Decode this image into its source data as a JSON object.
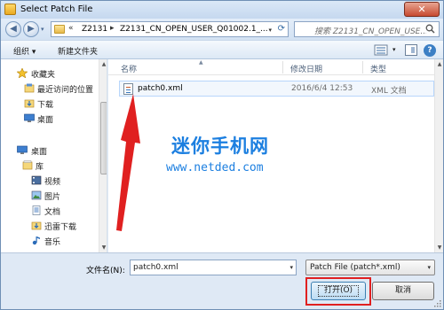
{
  "window": {
    "title": "Select Patch File",
    "close_label": "✕"
  },
  "address": {
    "chevron": "«",
    "segment1": "Z2131",
    "separator": "▸",
    "segment2": "Z2131_CN_OPEN_USER_Q01002.1_...",
    "search_placeholder": "搜索 Z2131_CN_OPEN_USE..."
  },
  "toolbar": {
    "organize": "组织 ▾",
    "new_folder": "新建文件夹",
    "help": "?"
  },
  "nav": {
    "items": [
      {
        "label": "收藏夹",
        "icon": "star-icon"
      },
      {
        "label": "最近访问的位置",
        "icon": "recent-places-icon"
      },
      {
        "label": "下载",
        "icon": "download-folder-icon"
      },
      {
        "label": "桌面",
        "icon": "desktop-icon"
      },
      {
        "label": "桌面",
        "icon": "desktop-icon"
      },
      {
        "label": "库",
        "icon": "library-icon"
      },
      {
        "label": "视频",
        "icon": "video-icon"
      },
      {
        "label": "图片",
        "icon": "pictures-icon"
      },
      {
        "label": "文档",
        "icon": "documents-icon"
      },
      {
        "label": "迅雷下载",
        "icon": "thunder-download-icon"
      },
      {
        "label": "音乐",
        "icon": "music-icon"
      }
    ]
  },
  "columns": {
    "name": "名称",
    "modified": "修改日期",
    "type": "类型"
  },
  "files": [
    {
      "name": "patch0.xml",
      "modified": "2016/6/4 12:53",
      "type": "XML 文档"
    }
  ],
  "watermark": {
    "title": "迷你手机网",
    "url": "www.netded.com"
  },
  "bottom": {
    "filename_label": "文件名(N):",
    "filename_value": "patch0.xml",
    "filter_value": "Patch File (patch*.xml)",
    "open_label": "打开(O)",
    "cancel_label": "取消"
  },
  "colors": {
    "annotation_red": "#e02020",
    "watermark_blue": "#1c7fe0"
  }
}
